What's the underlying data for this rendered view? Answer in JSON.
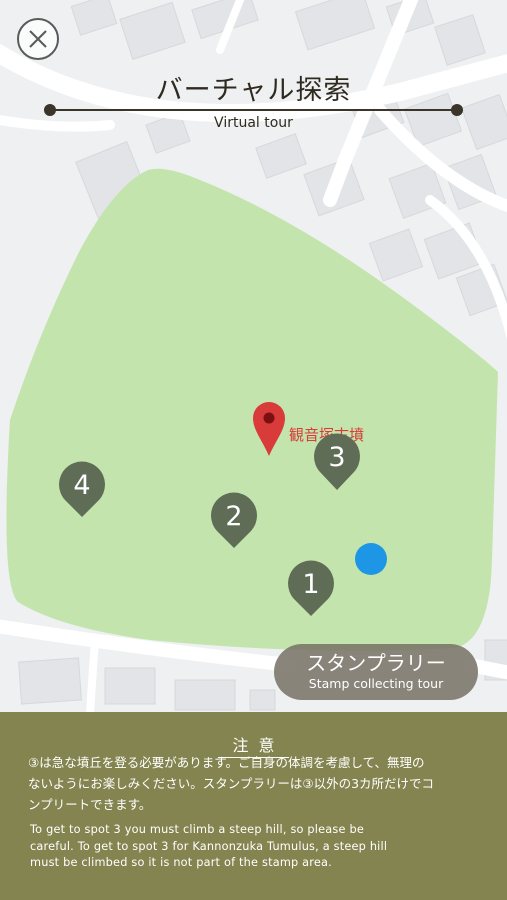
{
  "header": {
    "title": "バーチャル探索",
    "subtitle": "Virtual tour"
  },
  "map": {
    "park_color": "#c3e5ad",
    "landmark": {
      "name": "観音塚古墳",
      "pin_color": "#d93a3a"
    },
    "spots": [
      "1",
      "2",
      "3",
      "4"
    ],
    "spot_color": "#5f6d57",
    "current_location_color": "#1e96e6"
  },
  "stamp_button": {
    "label": "スタンプラリー",
    "sublabel": "Stamp collecting tour"
  },
  "notice": {
    "heading": "注意",
    "text_jp_1": "③は急な墳丘を登る必要があります。ご自身の体調を考慮して、無理の",
    "text_jp_2": "ないようにお楽しみください。スタンプラリーは③以外の3カ所だけでコ",
    "text_jp_3": "ンプリートできます。",
    "text_en_1": "To get to spot 3 you must climb a steep hill, so please be",
    "text_en_2": "careful. To get to spot 3 for Kannonzuka Tumulus, a steep hill",
    "text_en_3": "must be climbed so it is not part of the stamp area.",
    "background": "#848450"
  }
}
